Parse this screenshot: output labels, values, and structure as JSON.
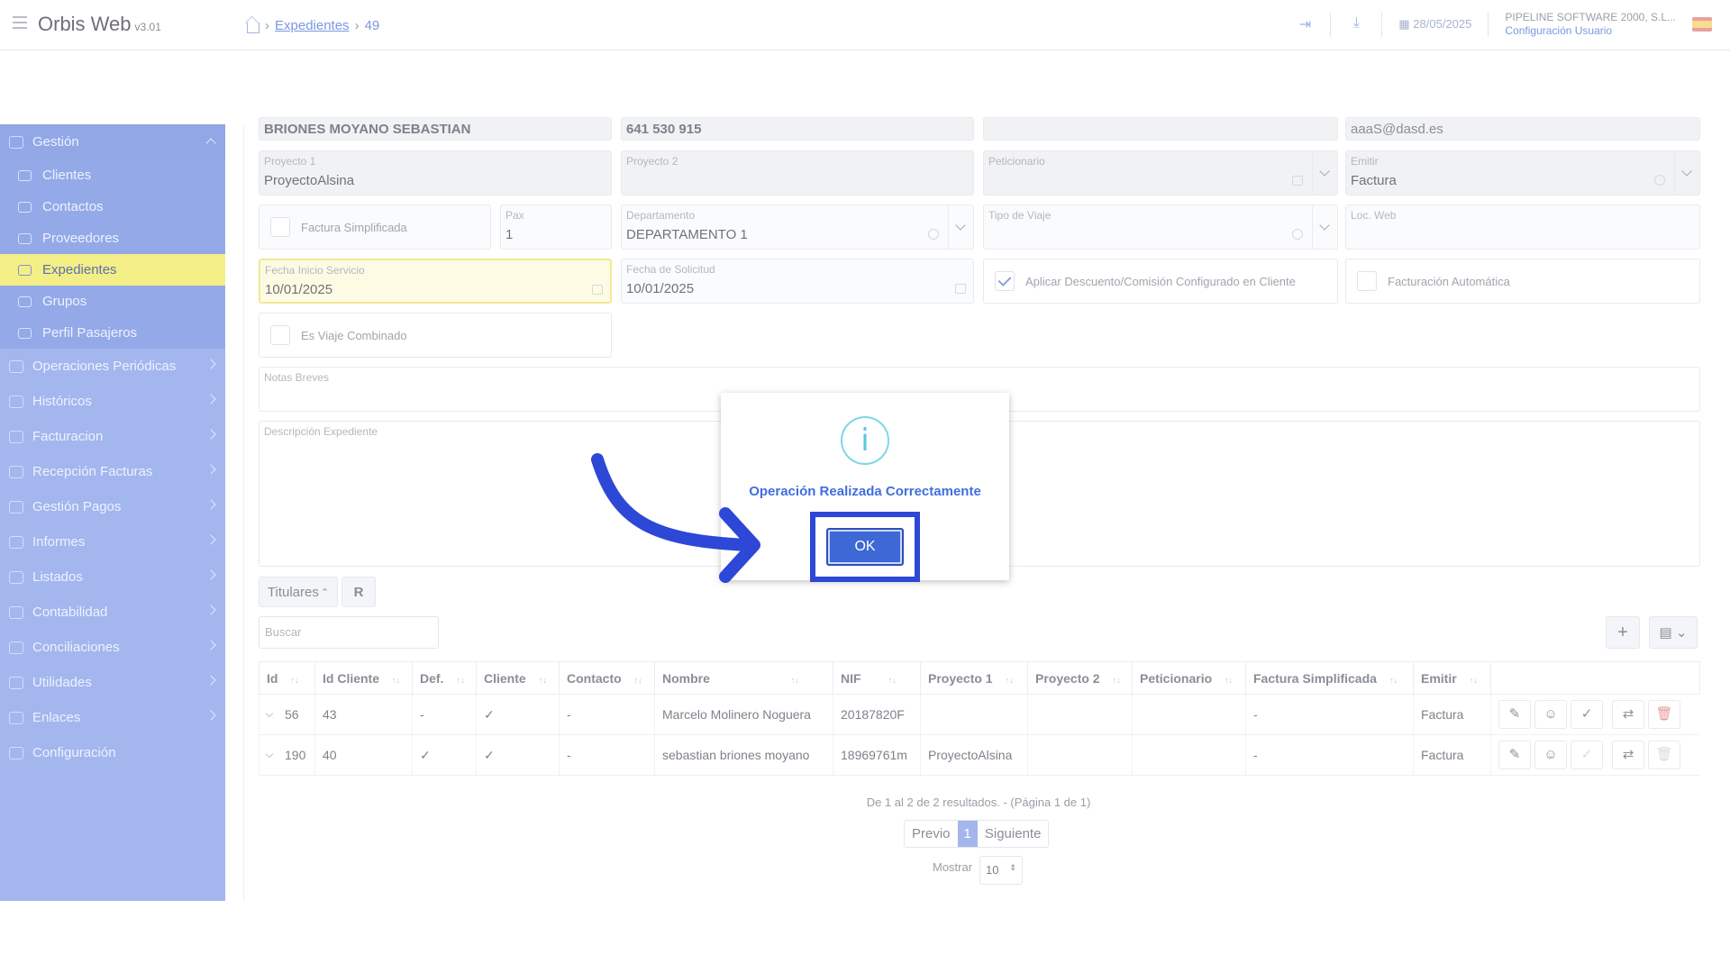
{
  "app": {
    "title": "Orbis Web",
    "version": "v3.01"
  },
  "breadcrumb": {
    "section": "Expedientes",
    "current": "49"
  },
  "header": {
    "date": "28/05/2025",
    "company": "PIPELINE SOFTWARE 2000, S.L...",
    "config_link": "Configuración Usuario"
  },
  "sidebar": {
    "group": "Gestión",
    "subitems": [
      "Clientes",
      "Contactos",
      "Proveedores",
      "Expedientes",
      "Grupos",
      "Perfil Pasajeros"
    ],
    "active": "Expedientes",
    "items": [
      "Operaciones Periódicas",
      "Históricos",
      "Facturacion",
      "Recepción Facturas",
      "Gestión Pagos",
      "Informes",
      "Listados",
      "Contabilidad",
      "Conciliaciones",
      "Utilidades",
      "Enlaces",
      "Configuración"
    ]
  },
  "form": {
    "row0": {
      "name": "BRIONES MOYANO SEBASTIAN",
      "phone": "641 530 915",
      "email": "aaaS@dasd.es"
    },
    "proyecto1": {
      "label": "Proyecto 1",
      "value": "ProyectoAlsina"
    },
    "proyecto2": {
      "label": "Proyecto 2",
      "value": ""
    },
    "peticionario": {
      "label": "Peticionario",
      "value": ""
    },
    "emitir": {
      "label": "Emitir",
      "value": "Factura"
    },
    "factura_simplificada": {
      "label": "Factura Simplificada"
    },
    "pax": {
      "label": "Pax",
      "value": "1"
    },
    "departamento": {
      "label": "Departamento",
      "value": "DEPARTAMENTO 1"
    },
    "tipo_viaje": {
      "label": "Tipo de Viaje",
      "value": ""
    },
    "loc_web": {
      "label": "Loc. Web",
      "value": ""
    },
    "fecha_inicio": {
      "label": "Fecha Inicio Servicio",
      "value": "10/01/2025"
    },
    "fecha_solicitud": {
      "label": "Fecha de Solicitud",
      "value": "10/01/2025"
    },
    "aplicar_descuento": {
      "label": "Aplicar Descuento/Comisión Configurado en Cliente",
      "checked": true
    },
    "facturacion_auto": {
      "label": "Facturación Automática",
      "checked": false
    },
    "viaje_combinado": {
      "label": "Es Viaje Combinado",
      "checked": false
    },
    "notas": {
      "label": "Notas Breves"
    },
    "descripcion": {
      "label": "Descripción Expediente"
    }
  },
  "titulares": {
    "tab_label": "Titulares",
    "search_placeholder": "Buscar"
  },
  "table": {
    "headers": [
      "Id",
      "Id Cliente",
      "Def.",
      "Cliente",
      "Contacto",
      "Nombre",
      "NIF",
      "Proyecto 1",
      "Proyecto 2",
      "Peticionario",
      "Factura Simplificada",
      "Emitir"
    ],
    "rows": [
      [
        "56",
        "43",
        "-",
        "✓",
        "-",
        "Marcelo Molinero Noguera",
        "20187820F",
        "",
        "",
        "",
        "-",
        "Factura"
      ],
      [
        "190",
        "40",
        "✓",
        "✓",
        "-",
        "sebastian briones moyano",
        "18969761m",
        "ProyectoAlsina",
        "",
        "",
        "-",
        "Factura"
      ]
    ]
  },
  "pagination": {
    "summary": "De 1 al 2 de 2 resultados. - (Página 1 de 1)",
    "prev": "Previo",
    "page": "1",
    "next": "Siguiente",
    "show_label": "Mostrar",
    "show_value": "10"
  },
  "modal": {
    "message": "Operación Realizada Correctamente",
    "ok": "OK",
    "icon": "i"
  },
  "colors": {
    "sidebar": "#a3b6ee",
    "active": "#f4ee86",
    "accent": "#3e68d6",
    "frame": "#2d47d6"
  }
}
